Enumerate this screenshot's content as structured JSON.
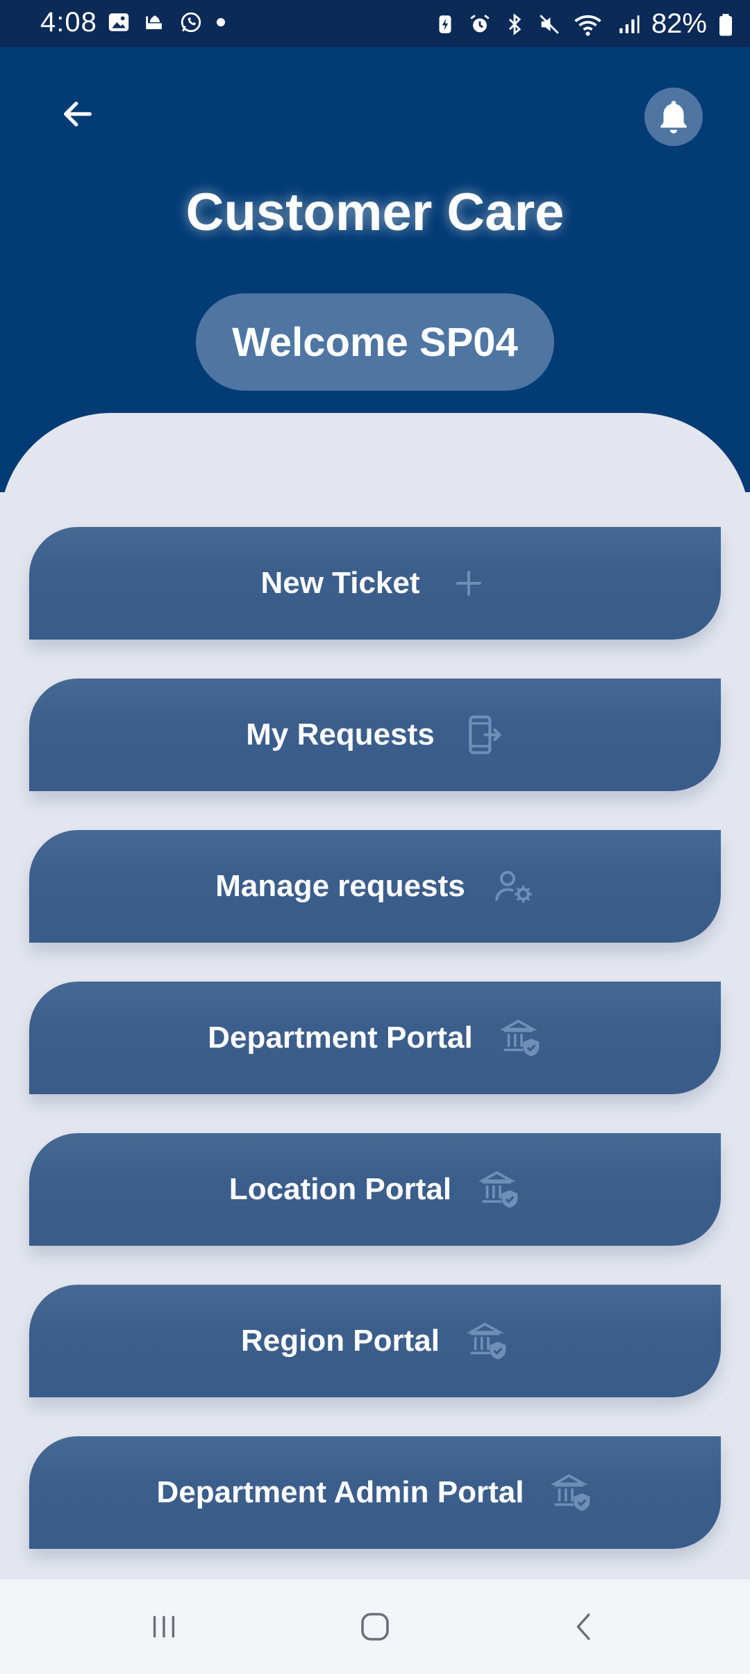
{
  "status_bar": {
    "time": "4:08",
    "battery": "82%",
    "left_icons": [
      "gallery-icon",
      "mosque-icon",
      "whatsapp-icon",
      "dot-icon"
    ],
    "right_icons": [
      "battery-saver-icon",
      "alarm-icon",
      "bluetooth-icon",
      "mute-icon",
      "wifi-icon",
      "signal-icon",
      "battery-icon"
    ]
  },
  "header": {
    "title": "Customer Care",
    "welcome": "Welcome SP04",
    "back_icon": "arrow-left-icon",
    "bell_icon": "bell-icon"
  },
  "menu": {
    "items": [
      {
        "label": "New Ticket",
        "icon": "plus-icon"
      },
      {
        "label": "My Requests",
        "icon": "phone-exit-icon"
      },
      {
        "label": "Manage requests",
        "icon": "user-gear-icon"
      },
      {
        "label": "Department Portal",
        "icon": "bank-shield-icon"
      },
      {
        "label": "Location Portal",
        "icon": "bank-shield-icon"
      },
      {
        "label": "Region Portal",
        "icon": "bank-shield-icon"
      },
      {
        "label": "Department Admin Portal",
        "icon": "bank-shield-icon"
      }
    ]
  },
  "nav_bar": {
    "items": [
      "recent-apps-icon",
      "home-icon",
      "back-icon"
    ]
  },
  "colors": {
    "header_bg": "#033b75",
    "status_bg": "#0b2a57",
    "button_bg": "#3c5e8c",
    "badge_bg": "#4f76a3",
    "panel_bg": "#e3e6ee"
  }
}
